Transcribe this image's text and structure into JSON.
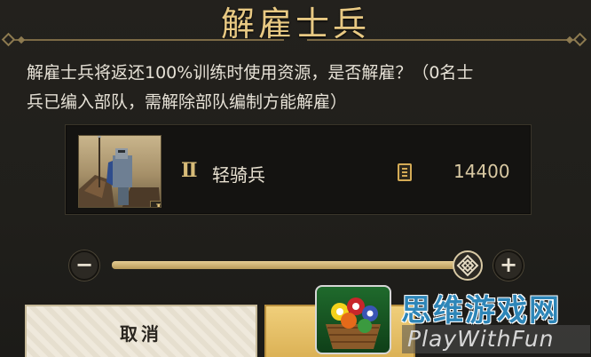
{
  "dialog": {
    "title": "解雇士兵",
    "message_line1": "解雇士兵将返还100%训练时使用资源，是否解雇？（0名士",
    "message_line2": "兵已编入部队，需解除部队编制方能解雇）"
  },
  "unit": {
    "tier": "II",
    "portrait_tier_badge": "II",
    "name": "轻骑兵",
    "resource_icon": "document-scroll-icon",
    "count": "14400"
  },
  "slider": {
    "minus_label": "−",
    "plus_label": "+",
    "fill_fraction": 1.0,
    "thumb_icon": "diamond-knot-icon"
  },
  "buttons": {
    "cancel_label": "取消",
    "confirm_label": ""
  },
  "watermark": {
    "title": "思维游戏网",
    "subtitle": "PlayWithFun",
    "logo_icon": "billiard-balls-basket-icon"
  },
  "colors": {
    "accent_gold": "#e8c983",
    "confirm_gold": "#dbb155",
    "panel_dark": "#141311"
  }
}
